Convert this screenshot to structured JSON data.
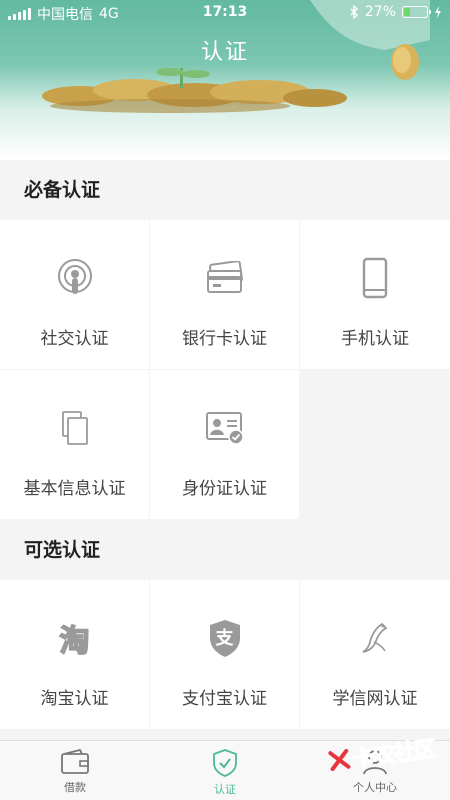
{
  "status_bar": {
    "carrier": "中国电信",
    "network": "4G",
    "time": "17:13",
    "battery": "27%",
    "battery_level": 0.27
  },
  "header": {
    "title": "认证"
  },
  "sections": [
    {
      "title": "必备认证",
      "items": [
        {
          "label": "社交认证",
          "icon": "social-icon"
        },
        {
          "label": "银行卡认证",
          "icon": "bank-card-icon"
        },
        {
          "label": "手机认证",
          "icon": "phone-icon"
        },
        {
          "label": "基本信息认证",
          "icon": "documents-icon"
        },
        {
          "label": "身份证认证",
          "icon": "id-card-icon"
        }
      ]
    },
    {
      "title": "可选认证",
      "items": [
        {
          "label": "淘宝认证",
          "icon": "taobao-icon",
          "glyph": "淘"
        },
        {
          "label": "支付宝认证",
          "icon": "alipay-icon",
          "glyph": "支"
        },
        {
          "label": "学信网认证",
          "icon": "xuexin-icon"
        }
      ]
    }
  ],
  "tabbar": {
    "items": [
      {
        "label": "借款",
        "icon": "wallet-icon"
      },
      {
        "label": "认证",
        "icon": "shield-check-icon",
        "active": true
      },
      {
        "label": "个人中心",
        "icon": "person-icon"
      }
    ]
  },
  "watermark": {
    "text": "卡农社区"
  },
  "colors": {
    "accent": "#4cb89a",
    "icon_gray": "#9a9a9a",
    "section_bg": "#f4f4f4"
  }
}
